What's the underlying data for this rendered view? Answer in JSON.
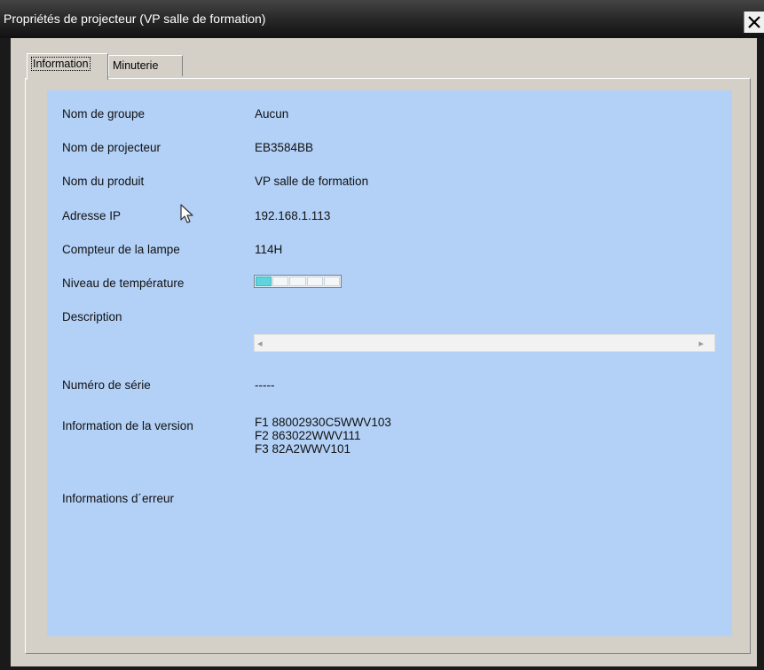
{
  "window": {
    "title": "Propriétés de projecteur (VP salle de formation)",
    "close_glyph": "✕"
  },
  "tabs": [
    {
      "label": "Information",
      "active": true
    },
    {
      "label": "Minuterie",
      "active": false
    }
  ],
  "info": {
    "group_name_label": "Nom de groupe",
    "group_name_value": "Aucun",
    "projector_name_label": "Nom de projecteur",
    "projector_name_value": "EB3584BB",
    "product_name_label": "Nom du produit",
    "product_name_value": "VP salle de formation",
    "ip_label": "Adresse IP",
    "ip_value": "192.168.1.113",
    "lamp_counter_label": "Compteur de la lampe",
    "lamp_counter_value": "114H",
    "temperature_label": "Niveau de température",
    "temperature_level": 1,
    "temperature_segments": 5,
    "description_label": "Description",
    "serial_label": "Numéro de série",
    "serial_value": "-----",
    "version_label": "Information de la version",
    "version_lines": [
      "F1 88002930C5WWV103",
      "F2 863022WWV111",
      "F3 82A2WWV101"
    ],
    "error_label": "Informations d´erreur"
  },
  "description_scrollbar": {
    "left_arrow": "◂",
    "right_arrow": "▸"
  },
  "colors": {
    "info_background": "#b3d1f7",
    "temperature_fill": "#5fd3de",
    "titlebar": "#1a1a1a"
  },
  "icons": {
    "cursor": "mouse-pointer-icon",
    "close": "close-icon"
  }
}
